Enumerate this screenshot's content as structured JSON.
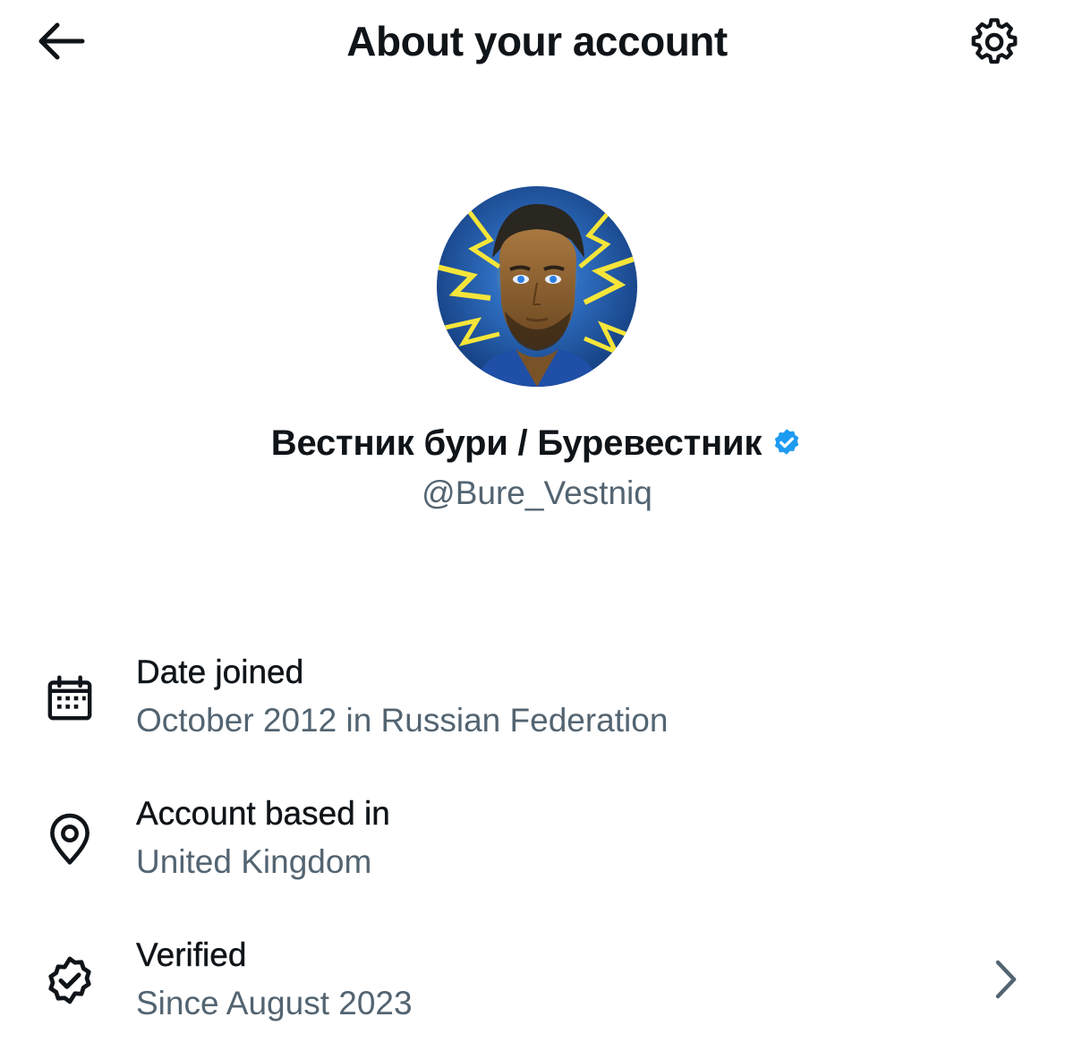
{
  "header": {
    "title": "About your account",
    "back_icon": "arrow-left-icon",
    "settings_icon": "gear-icon"
  },
  "profile": {
    "avatar": "profile-photo",
    "display_name": "Вестник бури / Буревестник",
    "verified": true,
    "handle": "@Bure_Vestniq"
  },
  "rows": [
    {
      "icon": "calendar-icon",
      "label": "Date joined",
      "value": "October 2012 in Russian Federation"
    },
    {
      "icon": "location-pin-icon",
      "label": "Account based in",
      "value": "United Kingdom"
    },
    {
      "icon": "verified-check-icon",
      "label": "Verified",
      "value": "Since August 2023",
      "has_chevron": true
    }
  ],
  "colors": {
    "text_primary": "#0f1419",
    "text_secondary": "#536471",
    "verified_blue": "#1d9bf0",
    "background": "#ffffff"
  }
}
